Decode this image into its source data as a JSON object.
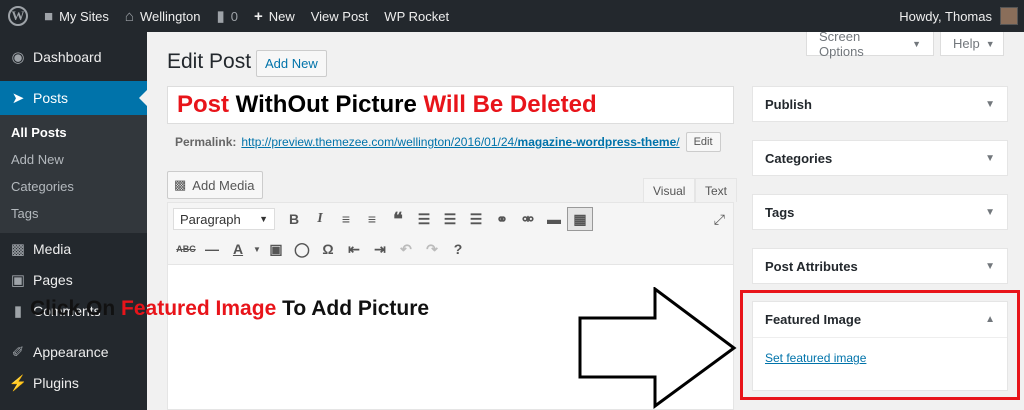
{
  "adminbar": {
    "my_sites": "My Sites",
    "site_name": "Wellington",
    "comments_count": "0",
    "new_label": "New",
    "view_post": "View Post",
    "wp_rocket": "WP Rocket",
    "howdy": "Howdy, Thomas"
  },
  "sidebar": {
    "dashboard": "Dashboard",
    "posts": "Posts",
    "sub": [
      "All Posts",
      "Add New",
      "Categories",
      "Tags"
    ],
    "media": "Media",
    "pages": "Pages",
    "comments": "Comments",
    "appearance": "Appearance",
    "plugins": "Plugins"
  },
  "header": {
    "screen_options": "Screen Options",
    "help": "Help",
    "title": "Edit Post",
    "add_new": "Add New"
  },
  "post": {
    "title_part1": "Post",
    "title_part2": " WithOut Picture ",
    "title_part3": "Will Be Deleted",
    "permalink_label": "Permalink:",
    "permalink_base": "http://preview.themezee.com/wellington/2016/01/24/",
    "permalink_slug": "magazine-wordpress-theme",
    "permalink_end": "/",
    "edit_label": "Edit"
  },
  "editor": {
    "add_media": "Add Media",
    "tab_visual": "Visual",
    "tab_text": "Text",
    "format_value": "Paragraph",
    "instruction_part1": "Click On ",
    "instruction_part2": "Featured Image",
    "instruction_part3": " To Add Picture"
  },
  "metaboxes": {
    "publish": "Publish",
    "categories": "Categories",
    "tags": "Tags",
    "post_attributes": "Post Attributes",
    "featured_image": "Featured Image",
    "set_featured": "Set featured image"
  },
  "colors": {
    "highlight": "#e8141a",
    "accent": "#0073aa",
    "admin_dark": "#23282d"
  }
}
